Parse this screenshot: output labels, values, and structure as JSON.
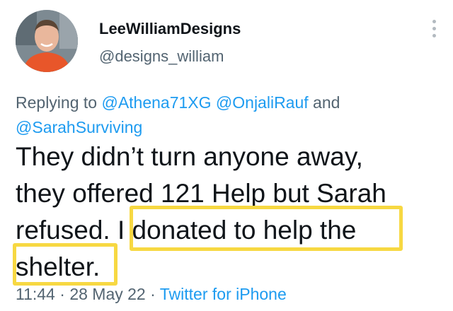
{
  "author": {
    "display_name": "LeeWilliamDesigns",
    "handle": "@designs_william",
    "avatar_icon": "profile-photo"
  },
  "reply": {
    "prefix": "Replying to",
    "mentions": [
      "@Athena71XG",
      "@OnjaliRauf",
      "@SarahSurviving"
    ],
    "joiner": "and"
  },
  "tweet": {
    "lines": [
      "They didn’t turn anyone away,",
      "they offered 121 Help but Sarah",
      "refused. I donated to help the",
      "shelter."
    ]
  },
  "meta": {
    "time": "11:44",
    "separator": "·",
    "date": "28 May 22",
    "source": "Twitter for iPhone"
  },
  "colors": {
    "link": "#1d9bf0",
    "secondary_text": "#536471",
    "highlight_box": "#f7d842"
  }
}
